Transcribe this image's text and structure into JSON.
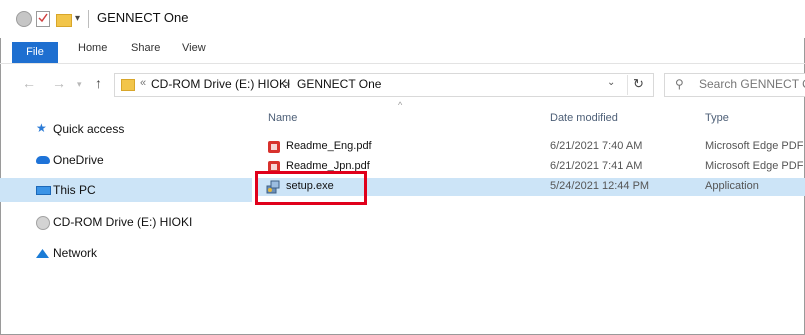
{
  "window": {
    "title": "GENNECT One"
  },
  "ribbon": {
    "tabs": [
      "File",
      "Home",
      "Share",
      "View"
    ]
  },
  "address": {
    "crumbs": [
      "CD-ROM Drive (E:) HIOKI",
      "GENNECT One"
    ],
    "separator": ">",
    "search_placeholder": "Search GENNECT One"
  },
  "nav_pane": {
    "items": [
      {
        "label": "Quick access",
        "icon": "star-icon"
      },
      {
        "label": "OneDrive",
        "icon": "cloud-icon"
      },
      {
        "label": "This PC",
        "icon": "computer-icon",
        "selected": true
      },
      {
        "label": "CD-ROM Drive (E:) HIOKI",
        "icon": "cd-drive-icon"
      },
      {
        "label": "Network",
        "icon": "network-icon"
      }
    ]
  },
  "columns": {
    "name": "Name",
    "date": "Date modified",
    "type": "Type"
  },
  "files": [
    {
      "name": "Readme_Eng.pdf",
      "date": "6/21/2021 7:40 AM",
      "type": "Microsoft Edge PDF",
      "icon": "pdf-icon"
    },
    {
      "name": "Readme_Jpn.pdf",
      "date": "6/21/2021 7:41 AM",
      "type": "Microsoft Edge PDF",
      "icon": "pdf-icon"
    },
    {
      "name": "setup.exe",
      "date": "5/24/2021 12:44 PM",
      "type": "Application",
      "icon": "setup-exe-icon",
      "selected": true
    }
  ],
  "colors": {
    "accent": "#1e6fd0",
    "selection": "#cce4f7",
    "highlight_box": "#e0001b"
  }
}
